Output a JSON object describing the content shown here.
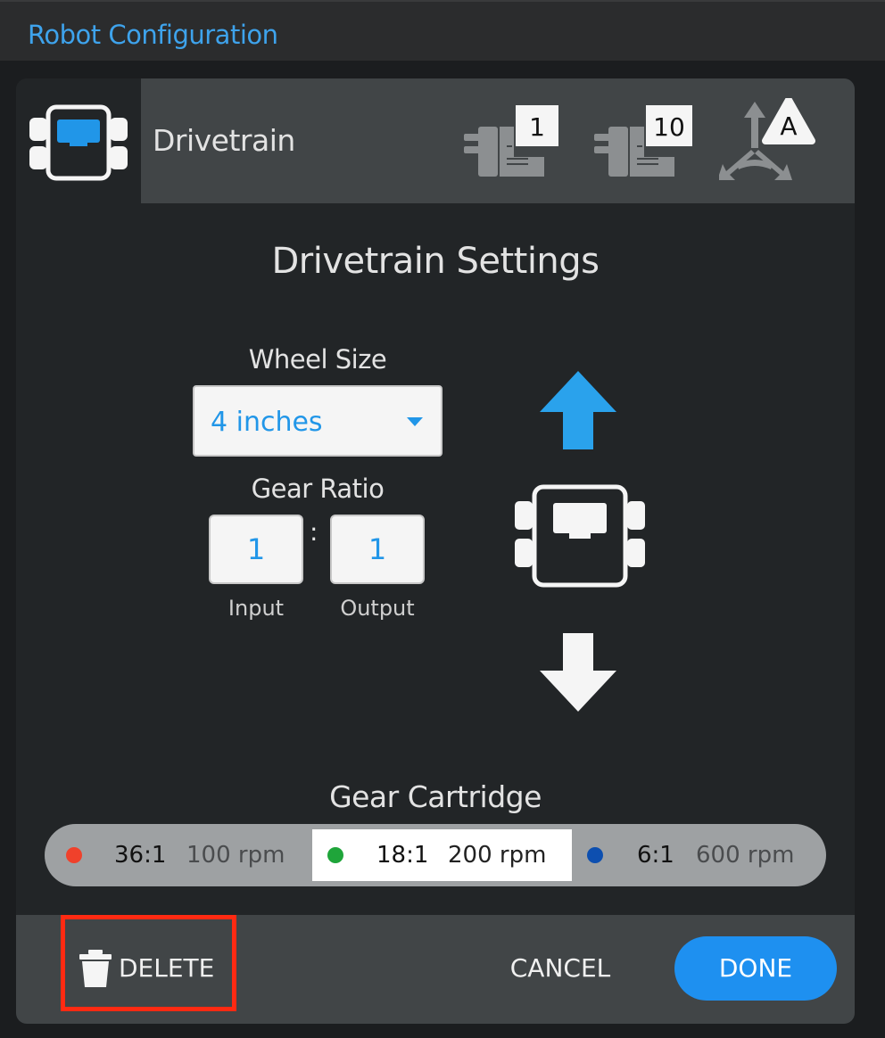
{
  "app": {
    "title": "Robot Configuration"
  },
  "header": {
    "device_name": "Drivetrain",
    "icons": [
      {
        "name": "motor-port-1-icon",
        "badge": "1"
      },
      {
        "name": "motor-port-10-icon",
        "badge": "10"
      },
      {
        "name": "gyro-port-a-icon",
        "badge": "A"
      }
    ]
  },
  "settings": {
    "title": "Drivetrain Settings",
    "wheel_size": {
      "label": "Wheel Size",
      "value": "4 inches"
    },
    "gear_ratio": {
      "label": "Gear Ratio",
      "input_value": "1",
      "output_value": "1",
      "separator": ":",
      "input_label": "Input",
      "output_label": "Output"
    }
  },
  "cartridge": {
    "label": "Gear Cartridge",
    "options": [
      {
        "ratio": "36:1",
        "rpm": "100 rpm",
        "color": "#f0412b",
        "selected": false
      },
      {
        "ratio": "18:1",
        "rpm": "200 rpm",
        "color": "#1fa53a",
        "selected": true
      },
      {
        "ratio": "6:1",
        "rpm": "600 rpm",
        "color": "#0d4fb0",
        "selected": false
      }
    ]
  },
  "footer": {
    "delete_label": "DELETE",
    "cancel_label": "CANCEL",
    "done_label": "DONE"
  },
  "colors": {
    "accent": "#2196e8",
    "highlight": "#ff2a12"
  }
}
